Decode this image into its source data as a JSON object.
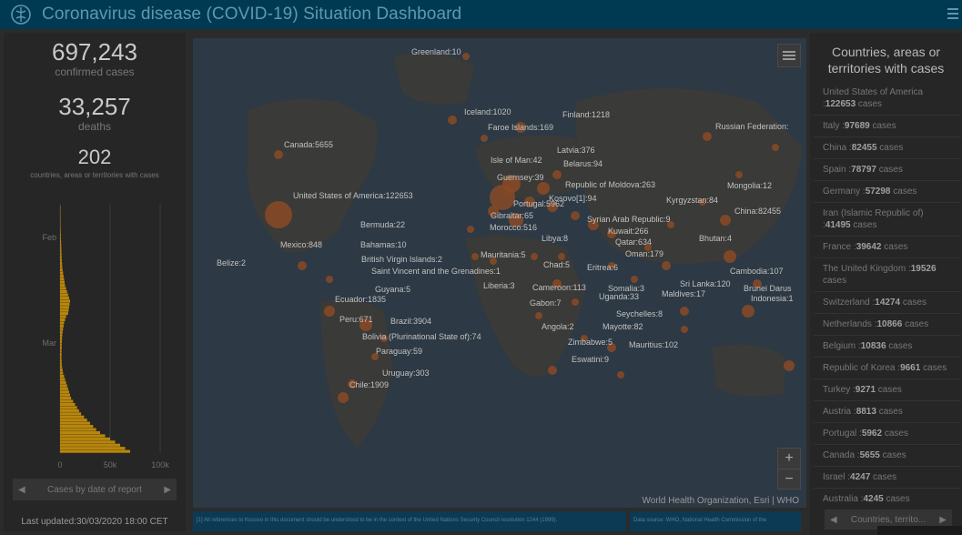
{
  "header": {
    "title": "Coronavirus disease (COVID-19) Situation Dashboard"
  },
  "stats": {
    "confirmed": {
      "value": "697,243",
      "label": "confirmed cases"
    },
    "deaths": {
      "value": "33,257",
      "label": "deaths"
    },
    "countries": {
      "value": "202",
      "label": "countries, areas or territories with cases"
    }
  },
  "epi_chart": {
    "tick_feb": "Feb",
    "tick_mar": "Mar",
    "x0": "0",
    "x1": "50k",
    "x2": "100k",
    "nav_label": "Cases by date of report"
  },
  "chart_data": {
    "type": "bar",
    "orientation": "horizontal",
    "xlabel": "",
    "ylabel": "",
    "xlim": [
      0,
      100000
    ],
    "x_ticks": [
      "0",
      "50k",
      "100k"
    ],
    "y_ticks": [
      "Feb",
      "Mar"
    ],
    "values": [
      100,
      150,
      200,
      250,
      300,
      400,
      500,
      600,
      700,
      800,
      900,
      1000,
      1200,
      1300,
      1400,
      1500,
      1600,
      1800,
      2000,
      2200,
      2500,
      3000,
      3500,
      4000,
      4500,
      5000,
      6000,
      7000,
      8000,
      9000,
      10000,
      9500,
      9000,
      8500,
      8000,
      6000,
      5000,
      4000,
      3500,
      3000,
      2500,
      2200,
      2000,
      1800,
      1700,
      1600,
      1500,
      1500,
      1500,
      1600,
      1700,
      2000,
      2500,
      3000,
      4000,
      5000,
      6000,
      7000,
      8000,
      9000,
      10000,
      11000,
      13000,
      15000,
      17000,
      19000,
      21000,
      24000,
      27000,
      30000,
      33000,
      36000,
      40000,
      45000,
      50000,
      55000,
      60000,
      65000,
      70000
    ]
  },
  "last_updated": "Last updated:30/03/2020 18:00 CET",
  "map": {
    "attribution": "World Health Organization, Esri | WHO",
    "zoom_in": "+",
    "zoom_out": "−",
    "labels": [
      {
        "text": "Greenland:10"
      },
      {
        "text": "Iceland:1020"
      },
      {
        "text": "Finland:1218"
      },
      {
        "text": "Faroe Islands:169"
      },
      {
        "text": "Russian Federation:"
      },
      {
        "text": "Canada:5655"
      },
      {
        "text": "Latvia:376"
      },
      {
        "text": "Isle of Man:42"
      },
      {
        "text": "Belarus:94"
      },
      {
        "text": "Guernsey:39"
      },
      {
        "text": "Republic of Moldova:263"
      },
      {
        "text": "Mongolia:12"
      },
      {
        "text": "United States of America:122653"
      },
      {
        "text": "Portugal:5962"
      },
      {
        "text": "Kosovo[1]:94"
      },
      {
        "text": "Kyrgyzstan:84"
      },
      {
        "text": "Gibraltar:65"
      },
      {
        "text": "China:82455"
      },
      {
        "text": "Syrian Arab Republic:9"
      },
      {
        "text": "Bermuda:22"
      },
      {
        "text": "Morocco:516"
      },
      {
        "text": "Kuwait:266"
      },
      {
        "text": "Libya:8"
      },
      {
        "text": "Bhutan:4"
      },
      {
        "text": "Qatar:634"
      },
      {
        "text": "Mexico:848"
      },
      {
        "text": "Bahamas:10"
      },
      {
        "text": "Oman:179"
      },
      {
        "text": "Mauritania:5"
      },
      {
        "text": "Belize:2"
      },
      {
        "text": "British Virgin Islands:2"
      },
      {
        "text": "Chad:5"
      },
      {
        "text": "Eritrea:6"
      },
      {
        "text": "Cambodia:107"
      },
      {
        "text": "Saint Vincent and the Grenadines:1"
      },
      {
        "text": "Sri Lanka:120"
      },
      {
        "text": "Brunei Darus"
      },
      {
        "text": "Liberia:3"
      },
      {
        "text": "Cameroon:113"
      },
      {
        "text": "Somalia:3"
      },
      {
        "text": "Guyana:5"
      },
      {
        "text": "Maldives:17"
      },
      {
        "text": "Indonesia:1"
      },
      {
        "text": "Ecuador:1835"
      },
      {
        "text": "Uganda:33"
      },
      {
        "text": "Gabon:7"
      },
      {
        "text": "Seychelles:8"
      },
      {
        "text": "Peru:671"
      },
      {
        "text": "Brazil:3904"
      },
      {
        "text": "Mayotte:82"
      },
      {
        "text": "Angola:2"
      },
      {
        "text": "Bolivia (Plurinational State of):74"
      },
      {
        "text": "Zimbabwe:5"
      },
      {
        "text": "Mauritius:102"
      },
      {
        "text": "Paraguay:59"
      },
      {
        "text": "Eswatini:9"
      },
      {
        "text": "Uruguay:303"
      },
      {
        "text": "Chile:1909"
      }
    ]
  },
  "footer": {
    "disclaimer": "[1] All references to Kosovo in this document should be understood to be in the context of the United Nations Security Council resolution 1244 (1999).",
    "source": "Data source: WHO, National Health Commission of the"
  },
  "right": {
    "title": "Countries, areas or territories with cases",
    "rows": [
      {
        "name": "United States of America",
        "cases": "122653",
        "suffix": " cases"
      },
      {
        "name": "Italy",
        "cases": "97689",
        "suffix": " cases"
      },
      {
        "name": "China",
        "cases": "82455",
        "suffix": " cases"
      },
      {
        "name": "Spain",
        "cases": "78797",
        "suffix": " cases"
      },
      {
        "name": "Germany",
        "cases": "57298",
        "suffix": " cases"
      },
      {
        "name": "Iran (Islamic Republic of)",
        "cases": "41495",
        "suffix": " cases"
      },
      {
        "name": "France",
        "cases": "39642",
        "suffix": " cases"
      },
      {
        "name": "The United Kingdom",
        "cases": "19526",
        "suffix": " cases"
      },
      {
        "name": "Switzerland",
        "cases": "14274",
        "suffix": " cases"
      },
      {
        "name": "Netherlands",
        "cases": "10866",
        "suffix": " cases"
      },
      {
        "name": "Belgium",
        "cases": "10836",
        "suffix": " cases"
      },
      {
        "name": "Republic of Korea",
        "cases": "9661",
        "suffix": " cases"
      },
      {
        "name": "Turkey",
        "cases": "9271",
        "suffix": " cases"
      },
      {
        "name": "Austria",
        "cases": "8813",
        "suffix": " cases"
      },
      {
        "name": "Portugal",
        "cases": "5962",
        "suffix": " cases"
      },
      {
        "name": "Canada",
        "cases": "5655",
        "suffix": " cases"
      },
      {
        "name": "Israel",
        "cases": "4247",
        "suffix": " cases"
      },
      {
        "name": "Australia",
        "cases": "4245",
        "suffix": " cases"
      }
    ],
    "nav_label": "Countries, territo..."
  },
  "colors": {
    "header_bg": "#003a52",
    "bubble": "#8a4a26",
    "bar": "#b8860b"
  }
}
